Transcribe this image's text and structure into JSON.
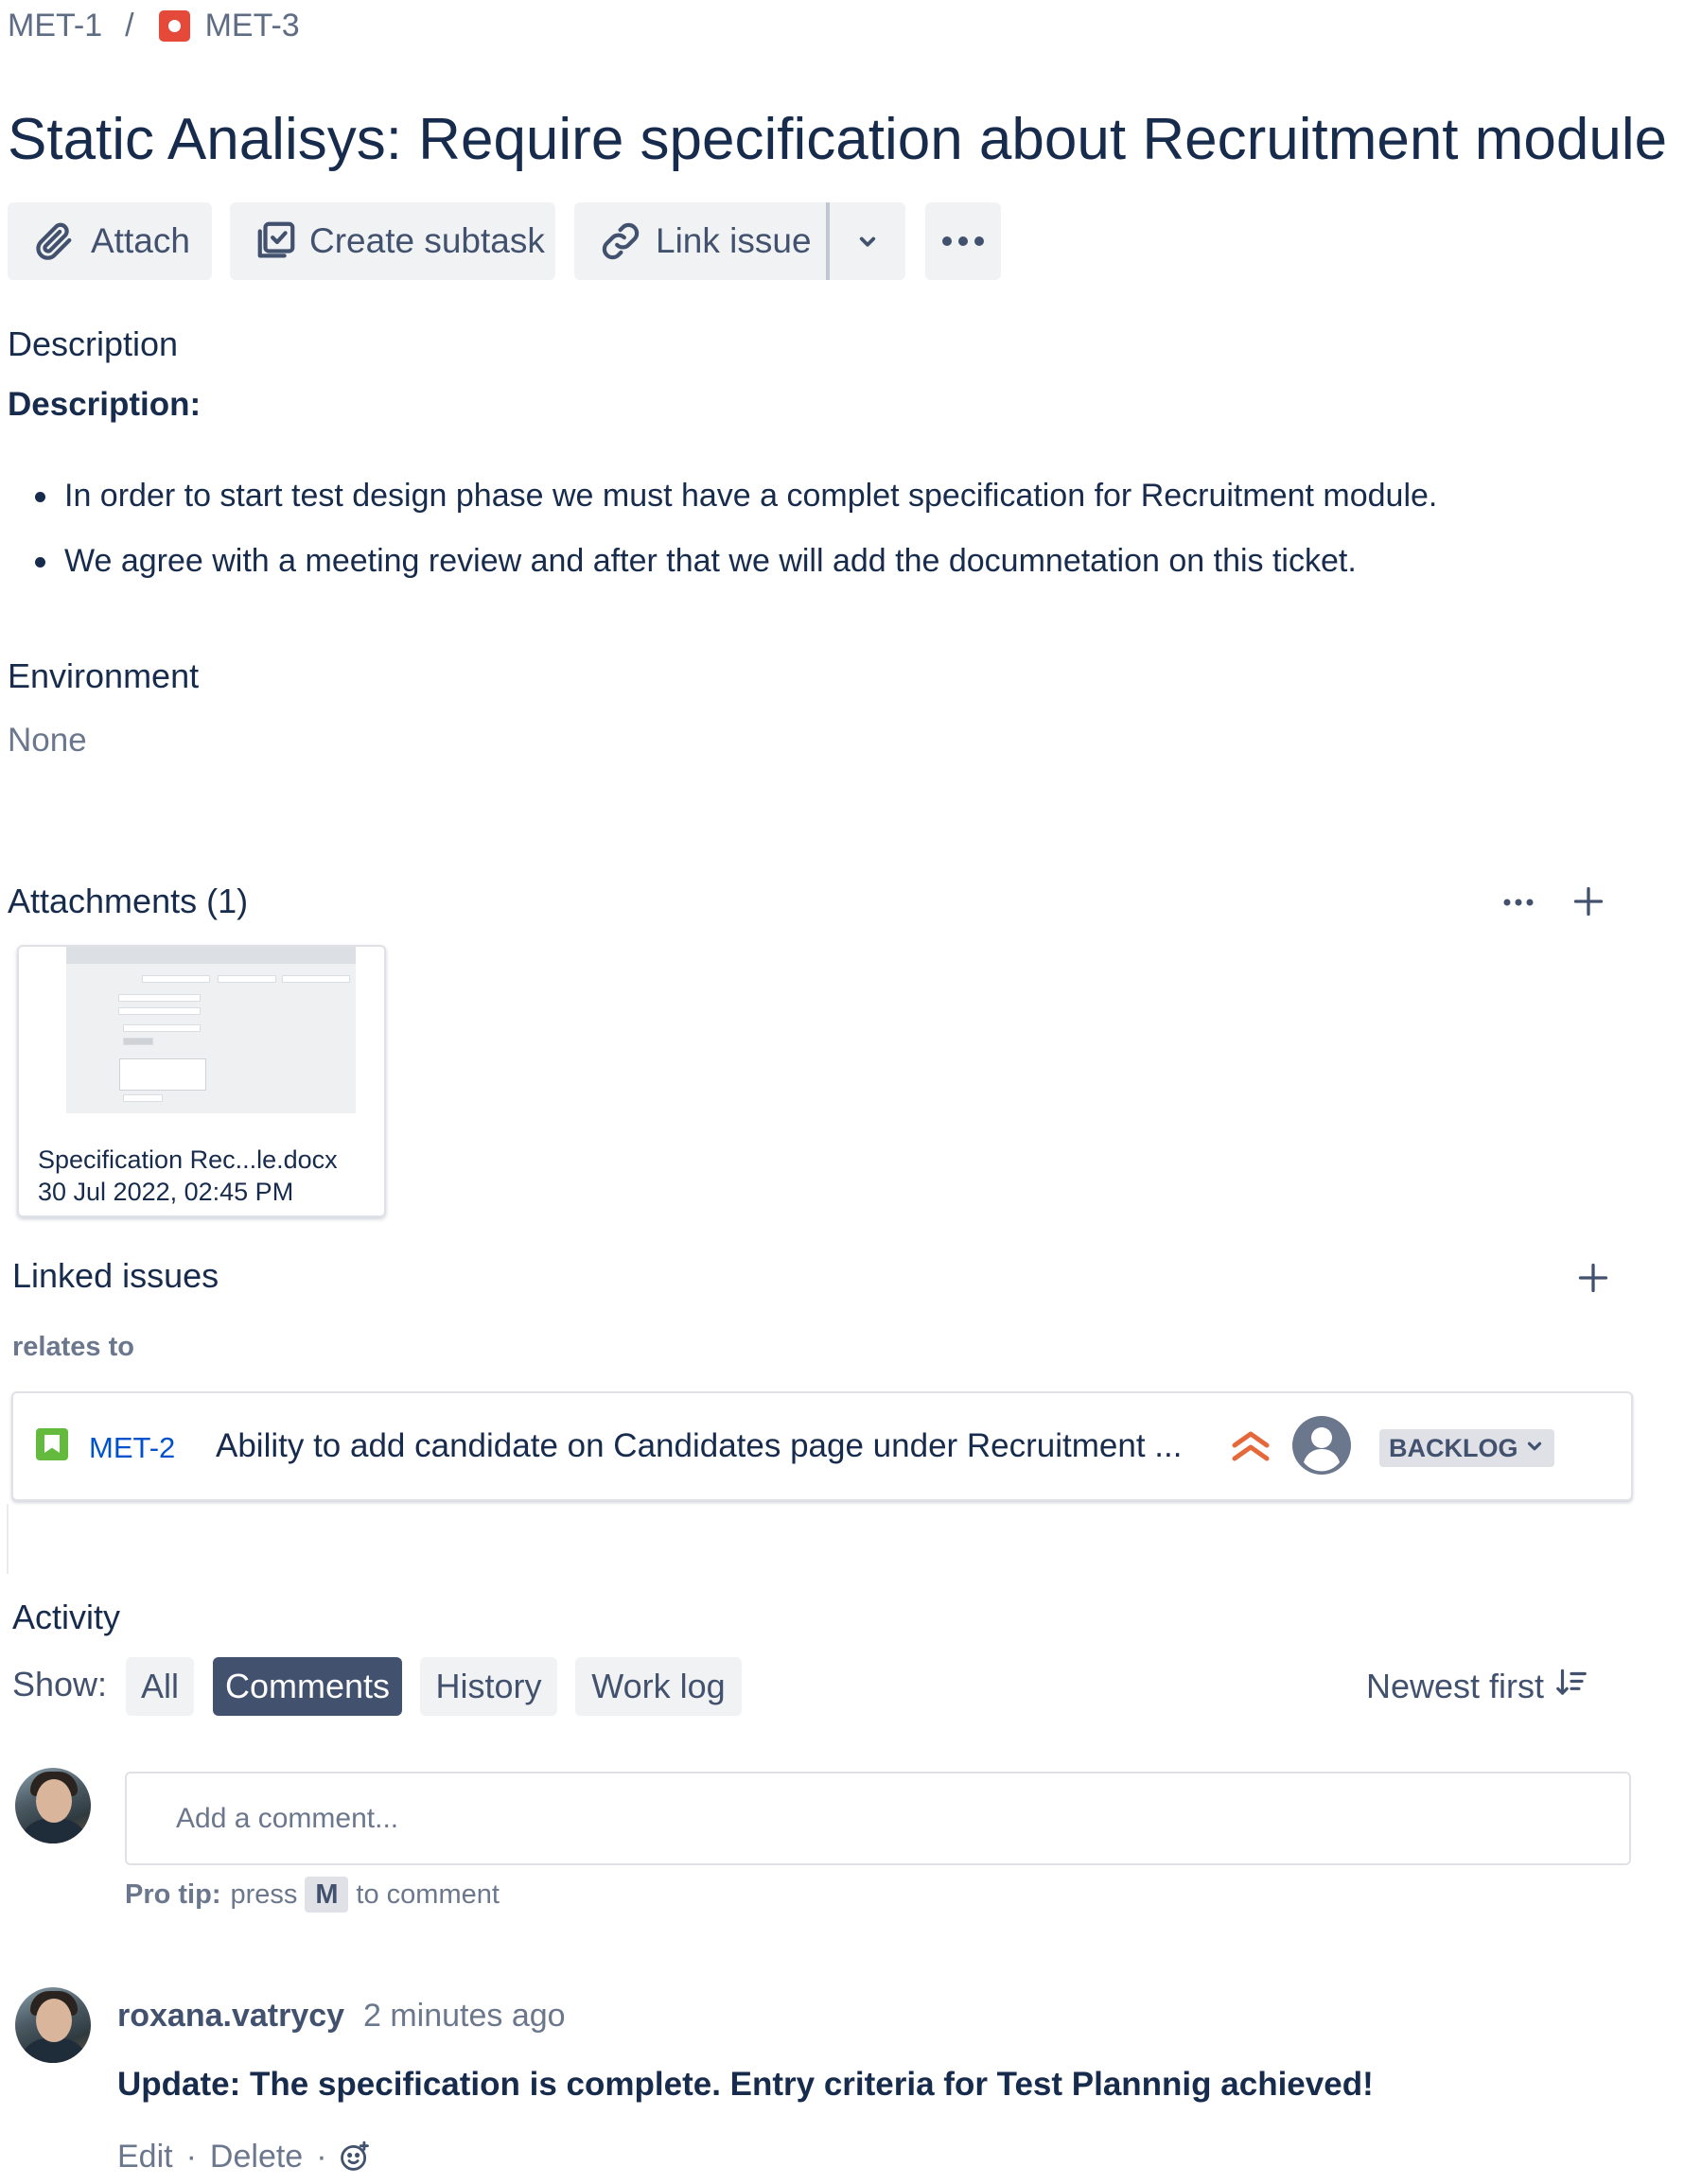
{
  "breadcrumb": {
    "parent": "MET-1",
    "separator": "/",
    "current": "MET-3"
  },
  "issue": {
    "title": "Static Analisys: Require specification about Recruitment module"
  },
  "toolbar": {
    "attach": "Attach",
    "create_subtask": "Create subtask",
    "link_issue": "Link issue"
  },
  "description": {
    "section_label": "Description",
    "heading": "Description:",
    "bullets": [
      "In order to start test design phase we must have a complet specification for Recruitment module.",
      "We agree with a meeting review and after that we will add the documnetation on this ticket."
    ]
  },
  "environment": {
    "label": "Environment",
    "value": "None"
  },
  "attachments": {
    "label": "Attachments (1)",
    "items": [
      {
        "name": "Specification Rec...le.docx",
        "date": "30 Jul 2022, 02:45 PM"
      }
    ]
  },
  "linked_issues": {
    "label": "Linked issues",
    "relation": "relates to",
    "items": [
      {
        "key": "MET-2",
        "summary": "Ability to add candidate on Candidates page under Recruitment ...",
        "status": "BACKLOG",
        "priority_icon": "highest-priority-icon",
        "type_icon": "story-icon"
      }
    ]
  },
  "activity": {
    "label": "Activity",
    "show_label": "Show:",
    "filters": [
      "All",
      "Comments",
      "History",
      "Work log"
    ],
    "active_filter": "Comments",
    "sort": "Newest first",
    "comment_placeholder": "Add a comment...",
    "pro_tip": {
      "prefix": "Pro tip:",
      "press": "press",
      "key": "M",
      "suffix": "to comment"
    },
    "comments": [
      {
        "author": "roxana.vatrycy",
        "time": "2 minutes ago",
        "body": "Update: The specification is complete. Entry criteria for Test Plannnig achieved!",
        "actions": {
          "edit": "Edit",
          "delete": "Delete",
          "separator": "·"
        }
      }
    ]
  },
  "colors": {
    "text": "#172b4d",
    "muted": "#6b778c",
    "link": "#0052cc",
    "bug": "#e5493a",
    "story": "#63ba3c",
    "priority": "#e5683a",
    "active_pill": "#42526e"
  }
}
